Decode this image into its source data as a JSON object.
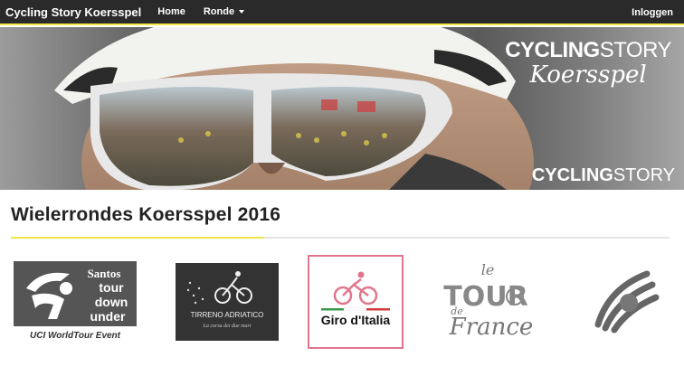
{
  "navbar": {
    "brand": "Cycling Story Koersspel",
    "links": [
      {
        "label": "Home",
        "dropdown": false
      },
      {
        "label": "Ronde",
        "dropdown": true
      }
    ],
    "login": "Inloggen",
    "accent_color": "#f2e84a"
  },
  "hero": {
    "logo_top": {
      "bold": "CYCLING",
      "light": "STORY",
      "script": "Koersspel"
    },
    "logo_bottom": {
      "bold": "CYCLING",
      "light": "STORY"
    }
  },
  "section": {
    "title": "Wielerrondes Koersspel 2016"
  },
  "races": [
    {
      "name": "Santos Tour Down Under",
      "lines": [
        "Santos",
        "tour",
        "down",
        "under",
        "UCI WorldTour Event"
      ],
      "selected": false
    },
    {
      "name": "Tirreno Adriatico",
      "lines": [
        "TIRRENO ADRIATICO",
        "La corsa dei due mari"
      ],
      "selected": false
    },
    {
      "name": "Giro d'Italia",
      "lines": [
        "Giro d'Italia"
      ],
      "selected": true,
      "highlight_color": "#e0768c"
    },
    {
      "name": "Le Tour de France",
      "lines": [
        "le",
        "TOUR",
        "de",
        "France"
      ],
      "selected": false
    },
    {
      "name": "Vuelta",
      "lines": [],
      "selected": false
    }
  ]
}
